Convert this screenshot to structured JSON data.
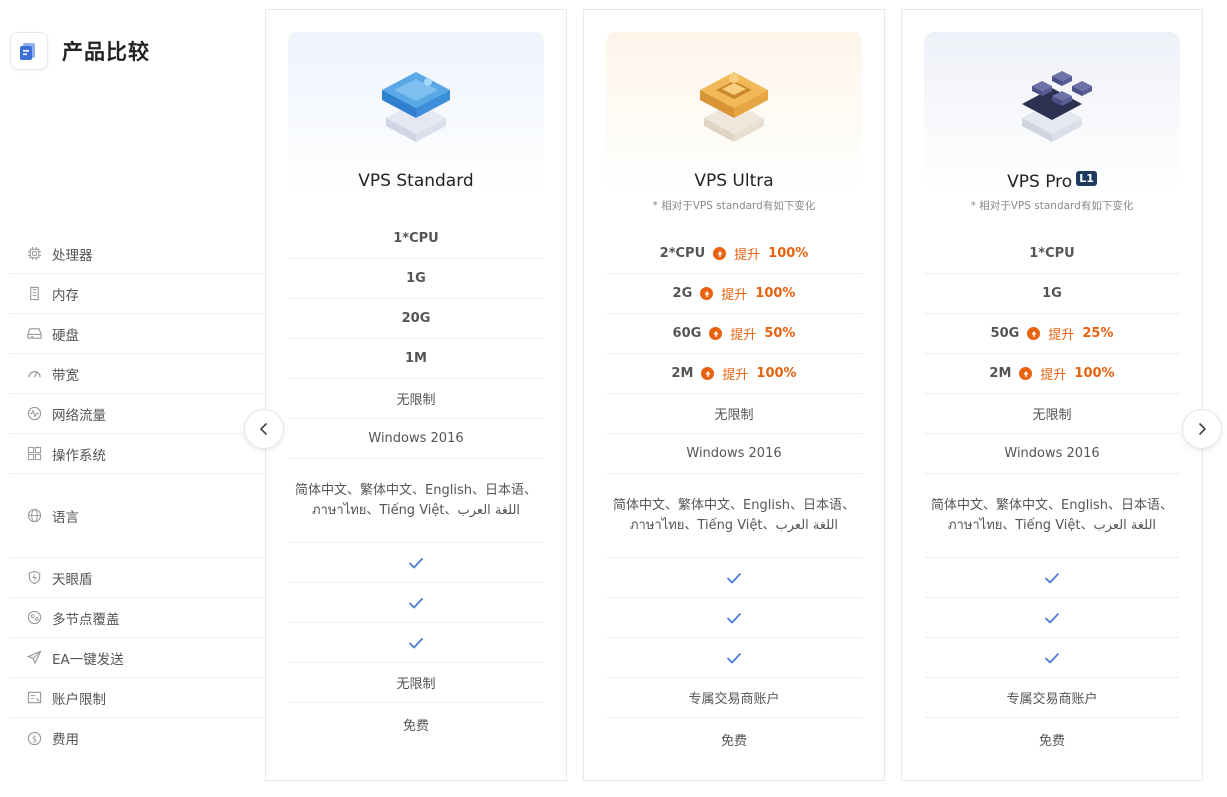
{
  "brand": {
    "title": "产品比较",
    "icon": "compare-document-icon"
  },
  "features": [
    {
      "label": "处理器",
      "icon": "cpu-icon"
    },
    {
      "label": "内存",
      "icon": "memory-icon"
    },
    {
      "label": "硬盘",
      "icon": "disk-icon"
    },
    {
      "label": "带宽",
      "icon": "speedometer-icon"
    },
    {
      "label": "网络流量",
      "icon": "traffic-pulse-icon"
    },
    {
      "label": "操作系统",
      "icon": "grid-icon"
    },
    {
      "label": "语言",
      "icon": "globe-icon"
    },
    {
      "label": "天眼盾",
      "icon": "shield-icon"
    },
    {
      "label": "多节点覆盖",
      "icon": "nodes-icon"
    },
    {
      "label": "EA一键发送",
      "icon": "send-icon"
    },
    {
      "label": "账户限制",
      "icon": "account-card-icon"
    },
    {
      "label": "费用",
      "icon": "dollar-icon"
    }
  ],
  "cards": [
    {
      "title": "VPS Standard",
      "note": "",
      "cpu": "1*CPU",
      "memory": "1G",
      "disk": "20G",
      "bandwidth": "1M",
      "traffic": "无限制",
      "os": "Windows 2016",
      "languages_1": "简体中文、繁体中文、English、日本语、",
      "languages_2": "ภาษาไทย、Tiếng Việt、اللغة العرب",
      "account": "无限制",
      "fee": "免费"
    },
    {
      "title": "VPS Ultra",
      "note": "* 相对于VPS standard有如下变化",
      "cpu": "2*CPU",
      "cpu_up": "100%",
      "memory": "2G",
      "memory_up": "100%",
      "disk": "60G",
      "disk_up": "50%",
      "bandwidth": "2M",
      "bandwidth_up": "100%",
      "traffic": "无限制",
      "os": "Windows 2016",
      "languages_1": "简体中文、繁体中文、English、日本语、",
      "languages_2": "ภาษาไทย、Tiếng Việt、اللغة العرب",
      "account": "专属交易商账户",
      "fee": "免费"
    },
    {
      "title": "VPS Pro",
      "badge": "L1",
      "note": "* 相对于VPS standard有如下变化",
      "cpu": "1*CPU",
      "memory": "1G",
      "disk": "50G",
      "disk_up": "25%",
      "bandwidth": "2M",
      "bandwidth_up": "100%",
      "traffic": "无限制",
      "os": "Windows 2016",
      "languages_1": "简体中文、繁体中文、English、日本语、",
      "languages_2": "ภาษาไทย、Tiếng Việt、اللغة العرب",
      "account": "专属交易商账户",
      "fee": "免费"
    }
  ],
  "upgrade_label": "提升",
  "colors": {
    "accent": "#e8620f",
    "check": "#4a7bd6",
    "badge": "#1e3a5f"
  },
  "nav": {
    "prev_icon": "chevron-left-icon",
    "next_icon": "chevron-right-icon"
  }
}
